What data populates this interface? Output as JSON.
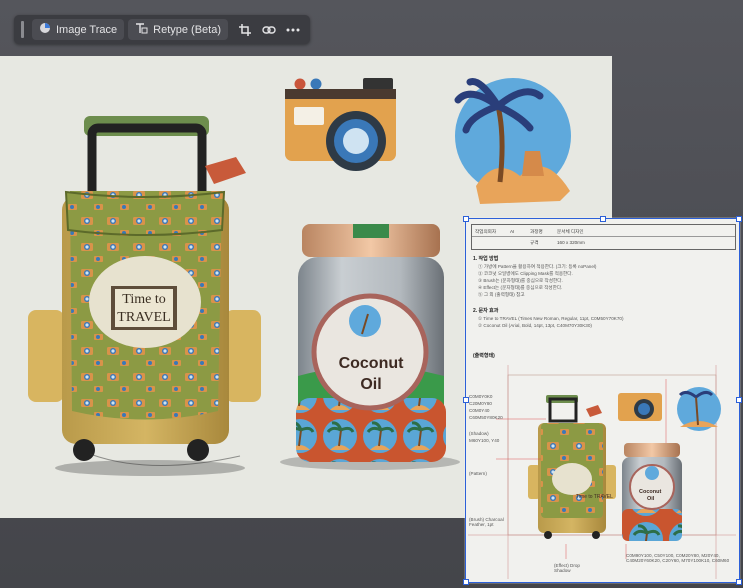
{
  "toolbar": {
    "image_trace_label": "Image Trace",
    "retype_label": "Retype (Beta)",
    "icons": [
      "image-trace-icon",
      "retype-icon",
      "crop-icon",
      "link-icon",
      "more-icon"
    ]
  },
  "artwork": {
    "tag_line1": "Time to",
    "tag_line2": "TRAVEL",
    "jar_line1": "Coconut",
    "jar_line2": "Oil"
  },
  "document": {
    "header_cells": [
      "작업의뢰자",
      "AI",
      "과정명",
      "문서체 디자인",
      "규격",
      "160 x 320mm"
    ],
    "section1_title": "1. 작업 방법",
    "section1_lines": [
      "① 가방에 Pattern을 활용하여 적용한다. (크기: 등록 noPanel)",
      "② 코코넛 오일병에도 Clipping Mask를 적용한다.",
      "③ Brush는 (문자형태)를 중심으로 작성한다.",
      "④ Effect는 (문자형태)를 중심으로 작성한다.",
      "⑤ 그 외 (출력형태) 참고"
    ],
    "section2_title": "2. 문자 효과",
    "section2_lines": [
      "① Time to TRAVEL (Times New Roman, Regular, 11pt, C0M50Y70K70)",
      "② Coconut Oil (Arial, Bold, 14pt, 13pt, C40M70Y30K30)"
    ],
    "output_title": "(출력형태)",
    "mini_tag": "Time to TRAVEL",
    "mini_jar_line1": "Coconut",
    "mini_jar_line2": "Oil",
    "callouts_left": [
      "C0M0Y0K0",
      "C20M0Y80",
      "C0M0Y40",
      "C60M50Y80K20",
      "(Shadow)",
      "M60Y100, Y40"
    ],
    "callout_pattern": "(Pattern)",
    "callout_bottom_left": "(Brush) Charcoal Feather, 1pt",
    "callout_bottom_mid": "(Effect) Drop Shadow",
    "callout_bottom_right": "C0M90Y100, C50Y100, C0M20Y80, M20Y40, C40M20Y60K20, C20Y60, M70Y100K10, C60M60"
  },
  "colors": {
    "workspace": "#4e4f55",
    "toolbar": "#3b3c41",
    "artboard": "#e7e8e2",
    "selection": "#2c60d8"
  }
}
